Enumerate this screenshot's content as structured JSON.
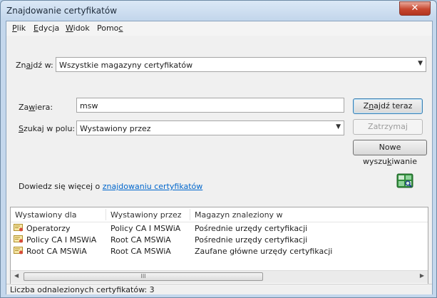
{
  "window": {
    "title": "Znajdowanie certyfikatów",
    "close_label": "✕"
  },
  "menu": [
    {
      "pre": "",
      "acc": "P",
      "post": "lik"
    },
    {
      "pre": "",
      "acc": "E",
      "post": "dycja"
    },
    {
      "pre": "",
      "acc": "W",
      "post": "idok"
    },
    {
      "pre": "Pomo",
      "acc": "c",
      "post": ""
    }
  ],
  "search": {
    "in_label_pre": "Zn",
    "in_label_acc": "a",
    "in_label_post": "jdź w:",
    "in_value": "Wszystkie magazyny certyfikatów",
    "contains_label_pre": "Za",
    "contains_label_acc": "w",
    "contains_label_post": "iera:",
    "contains_value": "msw",
    "field_label_pre": "",
    "field_label_acc": "S",
    "field_label_post": "zukaj w polu:",
    "field_value": "Wystawiony przez"
  },
  "buttons": {
    "find_pre": "Z",
    "find_acc": "n",
    "find_post": "ajdź teraz",
    "stop": "Zatrzymaj",
    "new_pre": "Nowe wyszu",
    "new_acc": "k",
    "new_post": "iwanie"
  },
  "help": {
    "text": "Dowiedz się więcej o ",
    "link": "znajdowaniu certyfikatów"
  },
  "list": {
    "columns": [
      "Wystawiony dla",
      "Wystawiony przez",
      "Magazyn znaleziony w"
    ],
    "rows": [
      [
        "Operatorzy",
        "Policy CA I MSWiA",
        "Pośrednie urzędy certyfikacji"
      ],
      [
        "Policy CA I MSWiA",
        "Root CA MSWiA",
        "Pośrednie urzędy certyfikacji"
      ],
      [
        "Root CA MSWiA",
        "Root CA MSWiA",
        "Zaufane główne urzędy certyfikacji"
      ]
    ],
    "scroll_grip": "III"
  },
  "status": {
    "text": "Liczba odnalezionych certyfikatów: 3"
  },
  "colors": {
    "link": "#0066cc",
    "close": "#c7472f",
    "title_bar": "#c4d7ec"
  },
  "icons": {
    "certificate": "certificate-icon",
    "find_certificate": "find-certificate-icon"
  }
}
